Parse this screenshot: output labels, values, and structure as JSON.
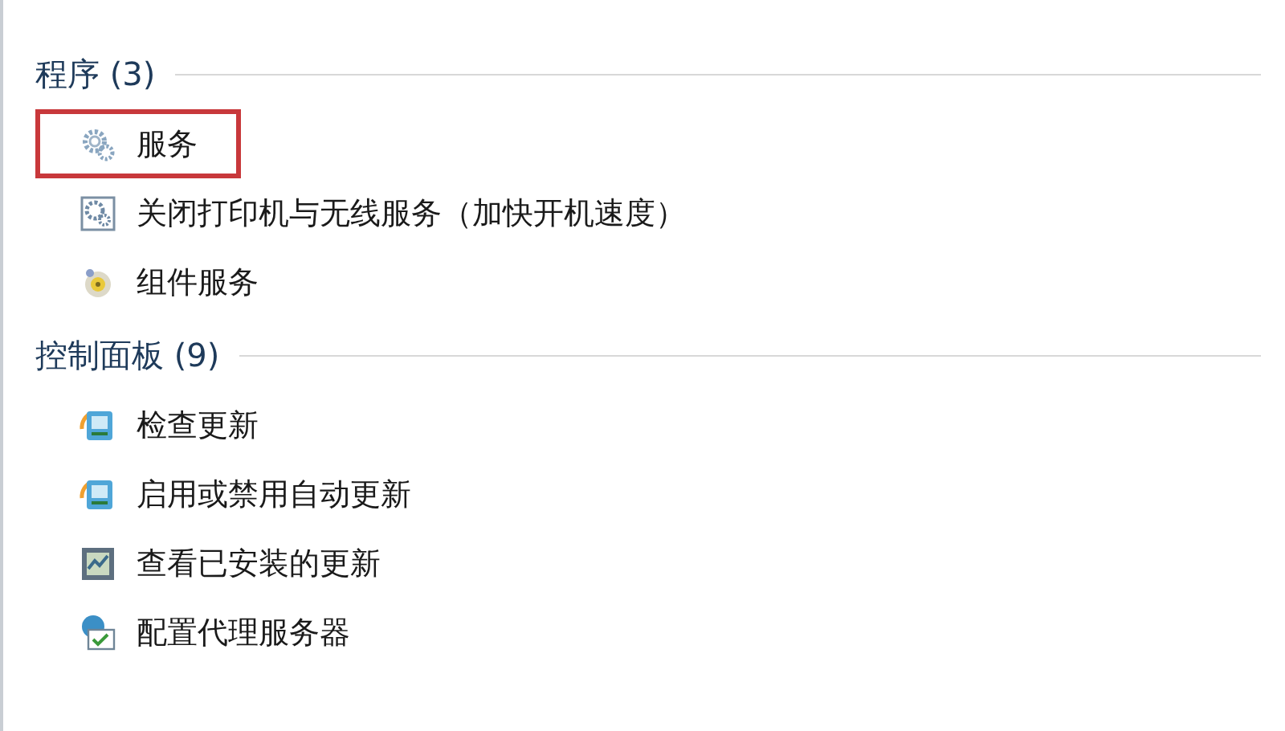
{
  "sections": [
    {
      "title": "程序 (3)",
      "items": [
        {
          "label": "服务",
          "kind": "gears",
          "highlighted": true
        },
        {
          "label": "关闭打印机与无线服务（加快开机速度）",
          "kind": "gearsdoc",
          "highlighted": false
        },
        {
          "label": "组件服务",
          "kind": "component",
          "highlighted": false
        }
      ]
    },
    {
      "title": "控制面板 (9)",
      "items": [
        {
          "label": "检查更新",
          "kind": "update",
          "highlighted": false
        },
        {
          "label": "启用或禁用自动更新",
          "kind": "update",
          "highlighted": false
        },
        {
          "label": "查看已安装的更新",
          "kind": "installed",
          "highlighted": false
        },
        {
          "label": "配置代理服务器",
          "kind": "proxy",
          "highlighted": false
        }
      ]
    }
  ]
}
